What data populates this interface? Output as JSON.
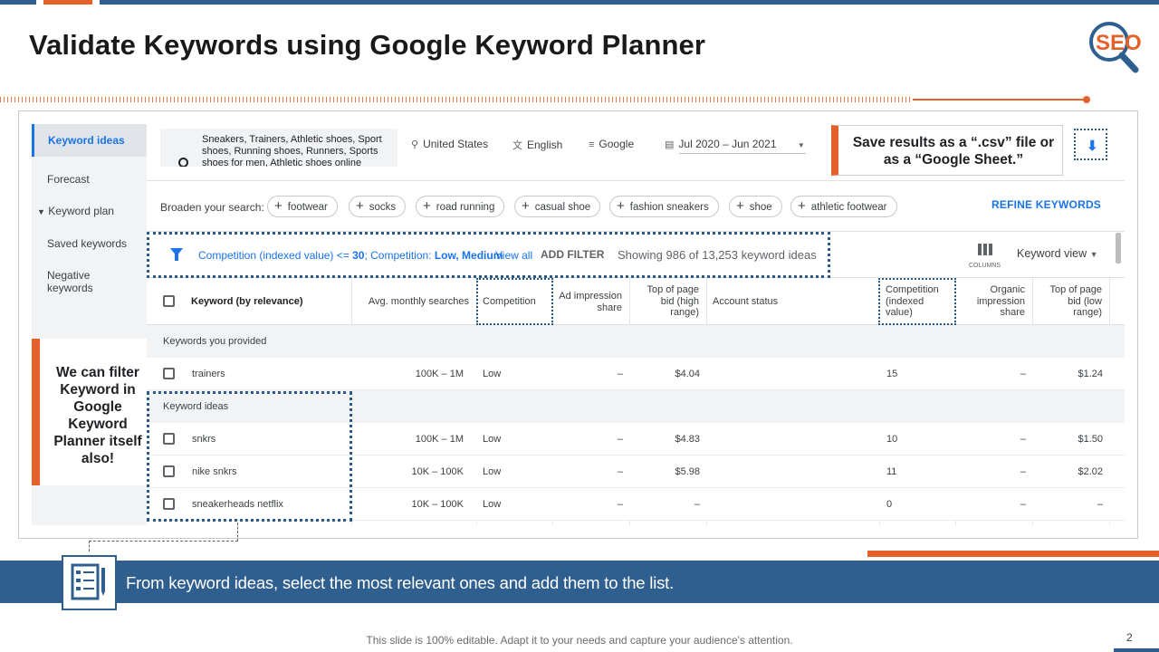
{
  "slide": {
    "title": "Validate Keywords using Google Keyword Planner",
    "logo_text": "SEO",
    "footer": "This slide is 100% editable. Adapt it to your needs and capture your audience's attention.",
    "page_number": "2",
    "banner_text": "From keyword ideas, select the most relevant ones and add them to the list.",
    "callout_save": "Save results as a “.csv” file or as a “Google Sheet.”",
    "callout_filter": "We can filter Keyword in Google Keyword Planner itself also!"
  },
  "sidebar": {
    "items": [
      "Keyword ideas",
      "Forecast",
      "Keyword plan",
      "Saved keywords",
      "Negative keywords"
    ]
  },
  "toolbar": {
    "search_text": "Sneakers, Trainers, Athletic shoes, Sport shoes, Running shoes, Runners, Sports shoes for men, Athletic shoes online",
    "location": "United States",
    "language": "English",
    "network": "Google",
    "date_range": "Jul 2020 – Jun 2021"
  },
  "broaden": {
    "label": "Broaden your search:",
    "chips": [
      "footwear",
      "socks",
      "road running",
      "casual shoe",
      "fashion sneakers",
      "shoe",
      "athletic footwear"
    ],
    "refine_label": "REFINE KEYWORDS"
  },
  "filter_bar": {
    "filter_part1": "Competition (indexed value) <= ",
    "filter_value": "30",
    "filter_part2": "; Competition: ",
    "filter_levels": "Low, Medium",
    "view_all": "View all",
    "add_filter": "ADD FILTER",
    "showing": "Showing 986 of 13,253 keyword ideas",
    "columns_label": "COLUMNS",
    "view_label": "Keyword view"
  },
  "table": {
    "headers": {
      "keyword": "Keyword (by relevance)",
      "searches": "Avg. monthly searches",
      "competition": "Competition",
      "ad_share": "Ad impression share",
      "bid_high": "Top of page bid (high range)",
      "account_status": "Account status",
      "comp_indexed": "Competition (indexed value)",
      "organic_share": "Organic impression share",
      "bid_low": "Top of page bid (low range)"
    },
    "section_provided": "Keywords you provided",
    "section_ideas": "Keyword ideas",
    "provided_rows": [
      {
        "keyword": "trainers",
        "searches": "100K – 1M",
        "competition": "Low",
        "ad_share": "–",
        "bid_high": "$4.04",
        "comp_indexed": "15",
        "organic_share": "–",
        "bid_low": "$1.24"
      }
    ],
    "idea_rows": [
      {
        "keyword": "snkrs",
        "searches": "100K – 1M",
        "competition": "Low",
        "ad_share": "–",
        "bid_high": "$4.83",
        "comp_indexed": "10",
        "organic_share": "–",
        "bid_low": "$1.50"
      },
      {
        "keyword": "nike snkrs",
        "searches": "10K – 100K",
        "competition": "Low",
        "ad_share": "–",
        "bid_high": "$5.98",
        "comp_indexed": "11",
        "organic_share": "–",
        "bid_low": "$2.02"
      },
      {
        "keyword": "sneakerheads netflix",
        "searches": "10K – 100K",
        "competition": "Low",
        "ad_share": "–",
        "bid_high": "–",
        "comp_indexed": "0",
        "organic_share": "–",
        "bid_low": "–"
      }
    ]
  },
  "colors": {
    "brand_blue": "#2e5f8f",
    "accent_orange": "#e4622a",
    "link_blue": "#1a73e8"
  }
}
